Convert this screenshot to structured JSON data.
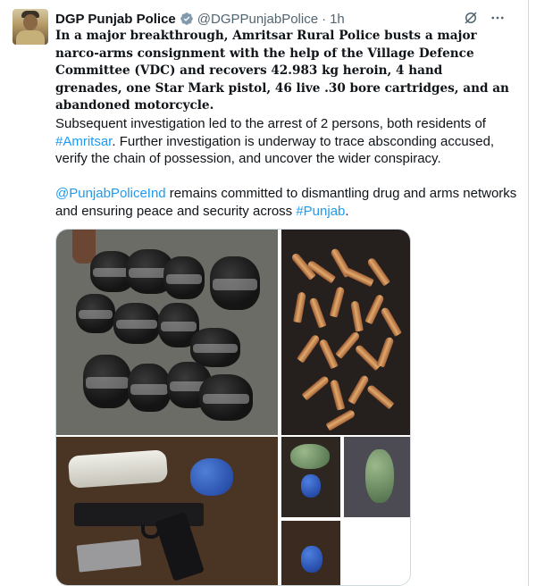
{
  "post": {
    "author_name": "DGP Punjab Police",
    "handle": "@DGPPunjabPolice",
    "separator": "·",
    "time": "1h",
    "lead_text": "In a major breakthrough, Amritsar Rural Police busts a major narco-arms consignment with the help of the Village Defence Committee (VDC) and recovers 42.983 kg heroin, 4 hand grenades, one Star Mark pistol, 46 live .30 bore cartridges, and an abandoned motorcycle.",
    "para1_pre": "Subsequent investigation led to the arrest of 2 persons, both residents of ",
    "para1_hashtag": "#Amritsar",
    "para1_post": ". Further investigation is underway to trace absconding accused, verify the chain of possession, and uncover the wider conspiracy.",
    "para2_mention": "@PunjabPoliceInd",
    "para2_mid": " remains committed to dismantling drug and arms networks and ensuring peace and security across ",
    "para2_hashtag": "#Punjab",
    "para2_end": "."
  },
  "icons": {
    "verified": "verified-badge-icon",
    "grok": "grok-icon",
    "more": "more-icon"
  },
  "colors": {
    "link": "#1d9bf0",
    "verified": "#829aab",
    "muted": "#536471"
  }
}
